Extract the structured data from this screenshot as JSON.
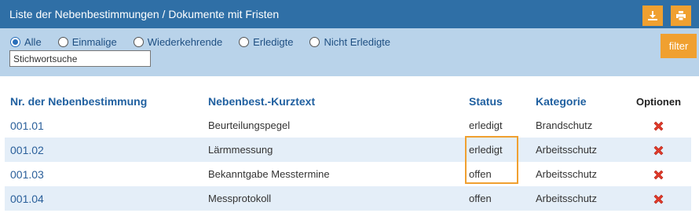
{
  "header": {
    "title": "Liste der Nebenbestimmungen / Dokumente mit Fristen",
    "download_icon": "download-icon",
    "print_icon": "print-icon",
    "accent_color": "#f0a030",
    "bar_color": "#2f6fa6"
  },
  "filters": {
    "options": [
      {
        "label": "Alle",
        "checked": true
      },
      {
        "label": "Einmalige",
        "checked": false
      },
      {
        "label": "Wiederkehrende",
        "checked": false
      },
      {
        "label": "Erledigte",
        "checked": false
      },
      {
        "label": "Nicht Erledigte",
        "checked": false
      }
    ],
    "search_placeholder": "Stichwortsuche",
    "filter_label": "filter"
  },
  "table": {
    "columns": [
      "Nr. der Nebenbestimmung",
      "Nebenbest.-Kurztext",
      "Status",
      "Kategorie",
      "Optionen"
    ],
    "rows": [
      {
        "nr": "001.01",
        "text": "Beurteilungspegel",
        "status": "erledigt",
        "kategorie": "Brandschutz",
        "option_icon": "delete-icon"
      },
      {
        "nr": "001.02",
        "text": "Lärmmessung",
        "status": "erledigt",
        "kategorie": "Arbeitsschutz",
        "option_icon": "delete-icon"
      },
      {
        "nr": "001.03",
        "text": "Bekanntgabe Messtermine",
        "status": "offen",
        "kategorie": "Arbeitsschutz",
        "option_icon": "delete-icon"
      },
      {
        "nr": "001.04",
        "text": "Messprotokoll",
        "status": "offen",
        "kategorie": "Arbeitsschutz",
        "option_icon": "delete-icon"
      }
    ]
  }
}
